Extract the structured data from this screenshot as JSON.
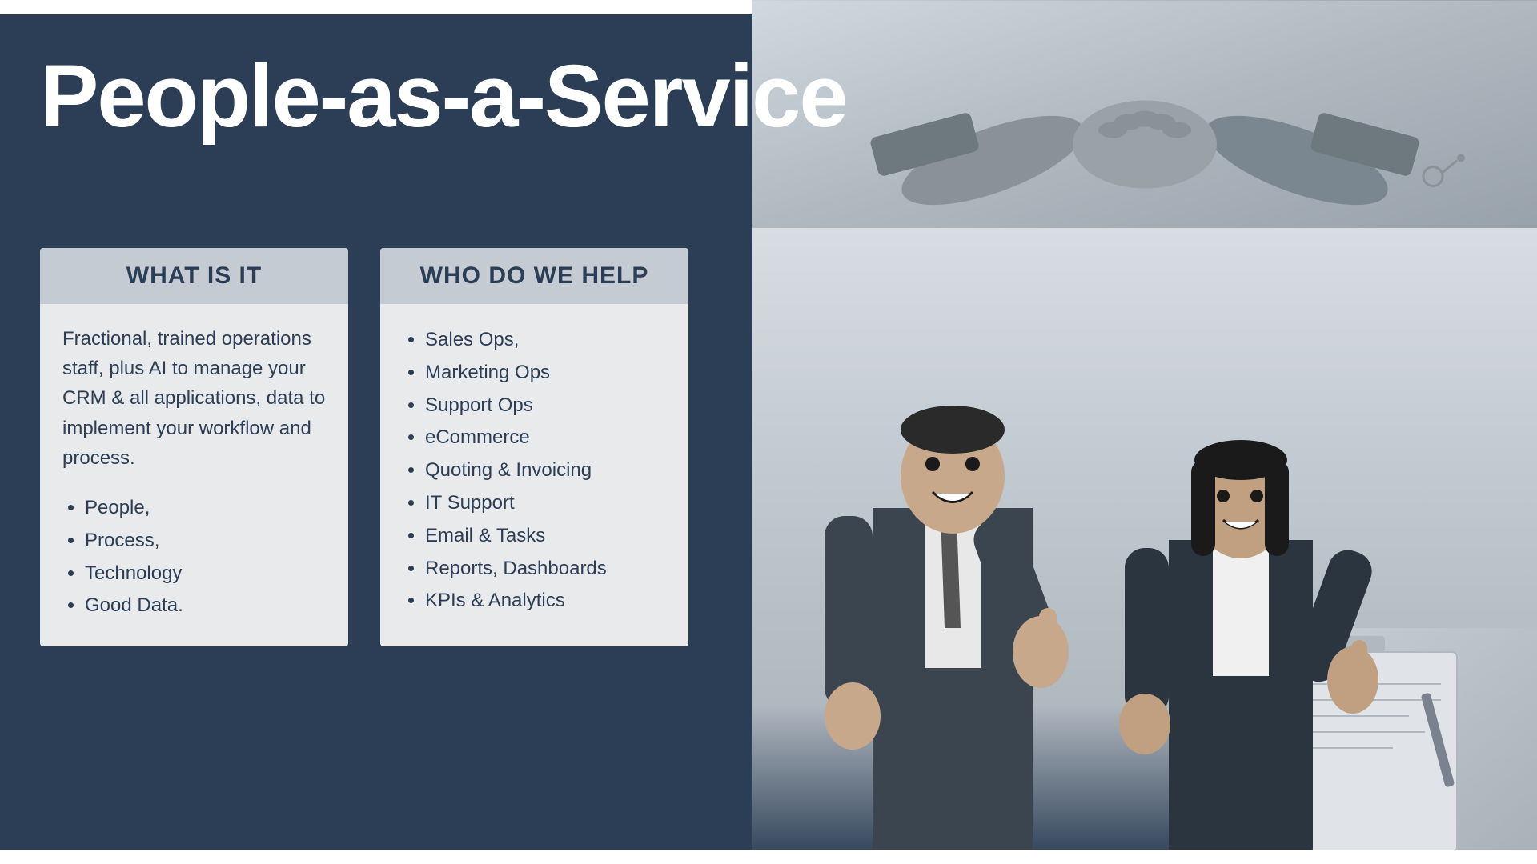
{
  "slide": {
    "title": "People-as-a-Service",
    "top_bar": "",
    "bottom_bar": ""
  },
  "what_is_it": {
    "header": "WHAT IS IT",
    "description": "Fractional, trained operations staff, plus AI to manage your CRM & all applications, data to implement your workflow and process.",
    "bullets": [
      "People,",
      "Process,",
      "Technology",
      "Good Data."
    ]
  },
  "who_do_we_help": {
    "header": "WHO DO WE HELP",
    "bullets": [
      "Sales Ops,",
      "Marketing Ops",
      "Support Ops",
      "eCommerce",
      "Quoting & Invoicing",
      "IT Support",
      "Email & Tasks",
      "Reports, Dashboards",
      "KPIs & Analytics"
    ]
  }
}
